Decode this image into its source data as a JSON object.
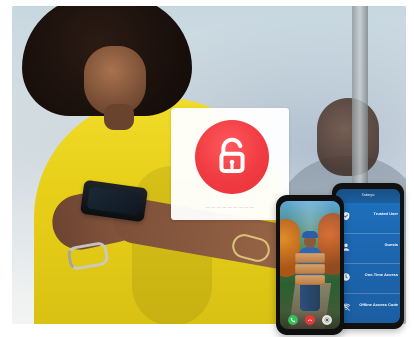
{
  "colors": {
    "unlock_red": "#ef3b41",
    "app_blue": "#1d72be",
    "shirt_yellow": "#e7cf18"
  },
  "unlock_card": {
    "icon": "unlock-icon",
    "caption": "— — — — — — — — —"
  },
  "phone_menu": {
    "title": "Tabeyo",
    "items": [
      {
        "label": "Trusted User",
        "sub": "",
        "icon": "shield-icon"
      },
      {
        "label": "Guests",
        "sub": "",
        "icon": "user-icon"
      },
      {
        "label": "One-Time Access",
        "sub": "",
        "icon": "time-icon"
      },
      {
        "label": "Offline Access Code",
        "sub": "",
        "icon": "wifi-off-icon"
      }
    ]
  },
  "phone_video": {
    "controls": [
      {
        "name": "answer",
        "icon": "phone-icon"
      },
      {
        "name": "end",
        "icon": "end-call-icon"
      },
      {
        "name": "settings",
        "icon": "gear-icon"
      }
    ]
  }
}
